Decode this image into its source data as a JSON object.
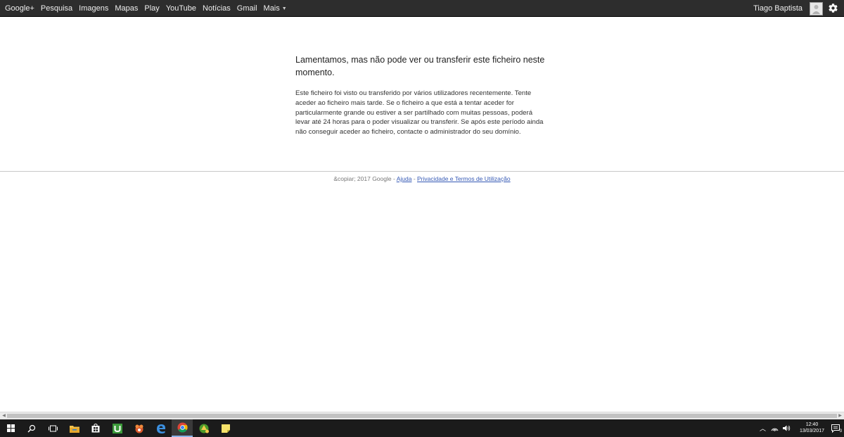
{
  "gbar": {
    "links": [
      "Google+",
      "Pesquisa",
      "Imagens",
      "Mapas",
      "Play",
      "YouTube",
      "Notícias",
      "Gmail",
      "Mais"
    ],
    "user_name": "Tiago Baptista",
    "avatar_icon": "user-avatar",
    "settings_icon": "gear-icon"
  },
  "main": {
    "title": "Lamentamos, mas não pode ver ou transferir este ficheiro neste momento.",
    "body": "Este ficheiro foi visto ou transferido por vários utilizadores recentemente. Tente aceder ao ficheiro mais tarde. Se o ficheiro a que está a tentar aceder for particularmente grande ou estiver a ser partilhado com muitas pessoas, poderá levar até 24 horas para o poder visualizar ou transferir. Se após este período ainda não conseguir aceder ao ficheiro, contacte o administrador do seu domínio."
  },
  "footer": {
    "copyright": "&copiar; 2017 Google",
    "separator": " - ",
    "help_link": "Ajuda",
    "privacy_link": "Privacidade e Termos de Utilização"
  },
  "taskbar": {
    "icons": [
      "windows-start-icon",
      "search-icon",
      "task-view-icon",
      "file-explorer-icon",
      "store-icon",
      "utorrent-icon",
      "app-orange-icon",
      "edge-icon",
      "chrome-icon",
      "app-green-icon",
      "sticky-notes-icon"
    ],
    "time": "12:40",
    "date": "13/03/2017",
    "notification_count": "3"
  },
  "colors": {
    "gbar_background": "#2d2d2d",
    "link_color": "#3559b5",
    "taskbar_background": "#1b1b1b"
  }
}
